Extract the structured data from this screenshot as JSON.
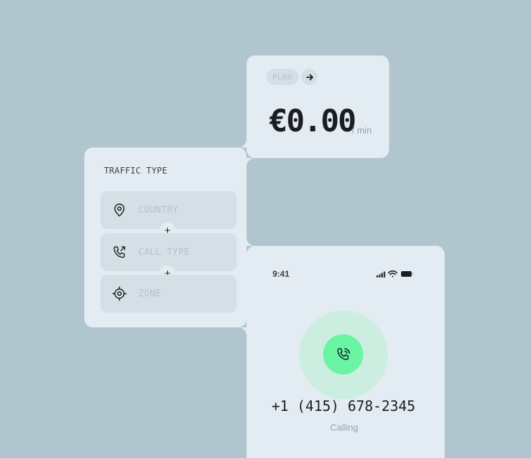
{
  "plan": {
    "pill_label": "PLAN",
    "price": "€0.00",
    "per_unit": "/ min"
  },
  "traffic": {
    "title": "TRAFFIC TYPE",
    "fields": [
      {
        "icon": "map-pin-icon",
        "placeholder": "COUNTRY"
      },
      {
        "icon": "phone-outgoing-icon",
        "placeholder": "CALL TYPE"
      },
      {
        "icon": "crosshair-icon",
        "placeholder": "ZONE"
      }
    ],
    "add_label": "+"
  },
  "phone": {
    "time": "9:41",
    "number": "+1 (415) 678-2345",
    "status": "Calling"
  },
  "colors": {
    "background": "#b1c5ce",
    "card": "#e3ecf2",
    "field": "#d5e0e6",
    "call_green": "#69f5a4",
    "ring_green": "#cbeee0"
  }
}
